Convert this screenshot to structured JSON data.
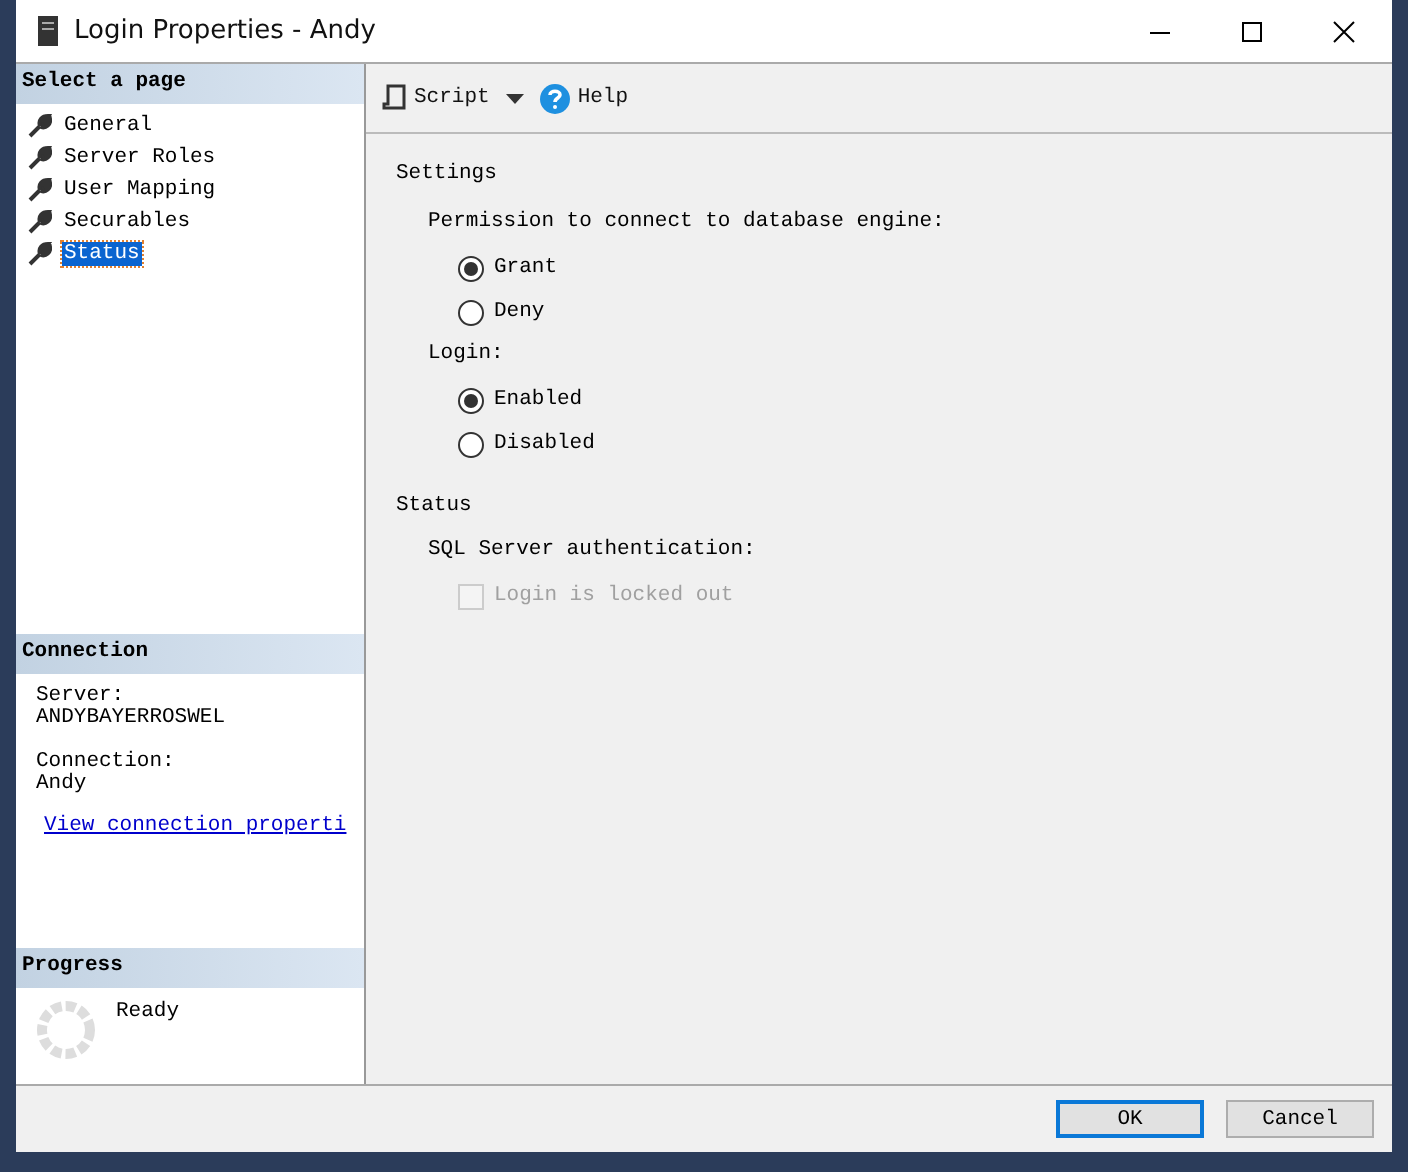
{
  "window": {
    "title": "Login Properties - Andy"
  },
  "sidebar": {
    "header": "Select a page",
    "items": [
      {
        "label": "General",
        "selected": false
      },
      {
        "label": "Server Roles",
        "selected": false
      },
      {
        "label": "User Mapping",
        "selected": false
      },
      {
        "label": "Securables",
        "selected": false
      },
      {
        "label": "Status",
        "selected": true
      }
    ]
  },
  "connection": {
    "header": "Connection",
    "server_label": "Server:",
    "server": "ANDYBAYERROSWEL",
    "connection_label": "Connection:",
    "connection": "Andy",
    "link": "View connection properti"
  },
  "progress": {
    "header": "Progress",
    "status": "Ready"
  },
  "toolbar": {
    "script": "Script",
    "help": "Help"
  },
  "settings": {
    "heading": "Settings",
    "groups": [
      {
        "label": "Permission to connect to database engine:",
        "options": [
          {
            "label": "Grant",
            "selected": true
          },
          {
            "label": "Deny",
            "selected": false
          }
        ]
      },
      {
        "label": "Login:",
        "options": [
          {
            "label": "Enabled",
            "selected": true
          },
          {
            "label": "Disabled",
            "selected": false
          }
        ]
      }
    ]
  },
  "status": {
    "heading": "Status",
    "label": "SQL Server authentication:",
    "checkbox": {
      "label": "Login is locked out",
      "checked": false,
      "disabled": true
    }
  },
  "buttons": [
    {
      "label": "OK",
      "default": true
    },
    {
      "label": "Cancel",
      "default": false
    }
  ]
}
